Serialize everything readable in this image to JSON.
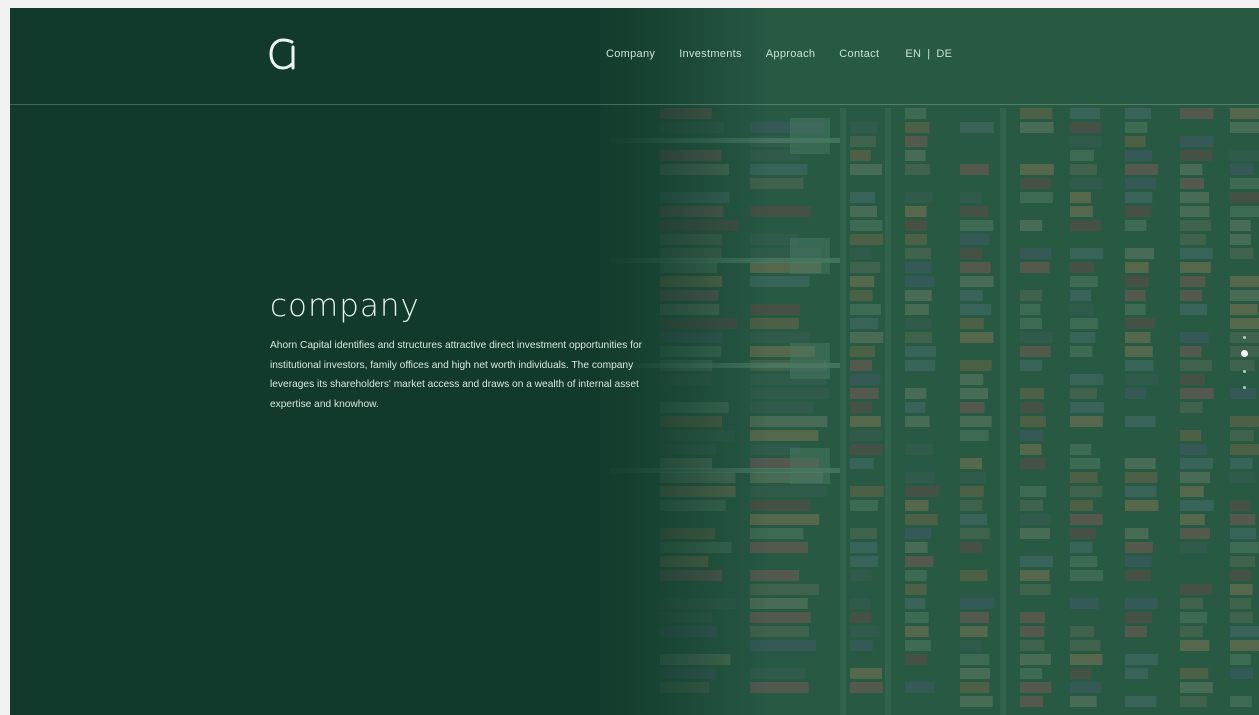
{
  "brand": {
    "logo_icon": "a-letter-logo-icon"
  },
  "nav": {
    "items": [
      "Company",
      "Investments",
      "Approach",
      "Contact"
    ],
    "languages": [
      "EN",
      "DE"
    ],
    "language_separator": "|"
  },
  "hero": {
    "title": "company",
    "text": "Ahorn Capital identifies and structures attractive direct investment opportunities for institutional investors, family offices and high net worth individuals. The company leverages its shareholders' market access and draws on a wealth of internal asset expertise and knowhow."
  },
  "pagination": {
    "total": 4,
    "active_index": 1
  },
  "colors": {
    "background": "#123a2c",
    "text": "#d6e9dd",
    "image_tint": "#2a5a44"
  }
}
